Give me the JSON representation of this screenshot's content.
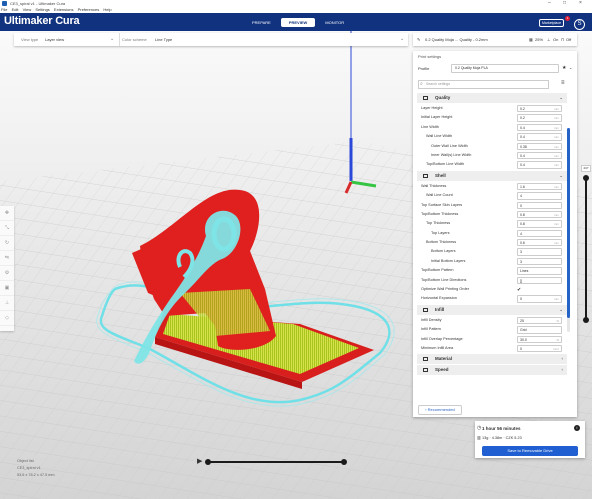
{
  "window": {
    "title": "CE3_spiral v1 - Ultimaker Cura"
  },
  "menu": [
    "File",
    "Edit",
    "View",
    "Settings",
    "Extensions",
    "Preferences",
    "Help"
  ],
  "header": {
    "logo": "Ultimaker Cura",
    "tabs": [
      "PREPARE",
      "PREVIEW",
      "MONITOR"
    ],
    "active_tab": "PREVIEW",
    "marketplace": "Marketplace",
    "badge": "1",
    "avatar": "S",
    "color": "#11327f"
  },
  "viewbar": {
    "view_type_label": "View type",
    "view_type_value": "Layer view",
    "color_scheme_label": "Color scheme",
    "color_scheme_value": "Line Type"
  },
  "printbar": {
    "profile": "0.2 Quality Moja ... Quality - 0.2mm",
    "infill": "25%",
    "support": "On",
    "adhesion": "Off"
  },
  "panel": {
    "title": "Print settings",
    "profile_label": "Profile",
    "profile_value": "0.2 Quality Moja PLA",
    "search_placeholder": "Search settings",
    "recommended": "Recommended"
  },
  "sections": [
    {
      "name": "Quality",
      "rows": [
        {
          "label": "Layer Height",
          "value": "0.2",
          "unit": "mm",
          "indent": 0
        },
        {
          "label": "Initial Layer Height",
          "value": "0.2",
          "unit": "mm",
          "indent": 0
        },
        {
          "label": "Line Width",
          "value": "0.4",
          "unit": "mm",
          "indent": 0
        },
        {
          "label": "Wall Line Width",
          "value": "0.4",
          "unit": "mm",
          "indent": 1
        },
        {
          "label": "Outer Wall Line Width",
          "value": "0.38",
          "unit": "mm",
          "indent": 2
        },
        {
          "label": "Inner Wall(s) Line Width",
          "value": "0.4",
          "unit": "mm",
          "indent": 2
        },
        {
          "label": "Top/Bottom Line Width",
          "value": "0.4",
          "unit": "mm",
          "indent": 1
        }
      ]
    },
    {
      "name": "Shell",
      "rows": [
        {
          "label": "Wall Thickness",
          "value": "1.6",
          "unit": "mm",
          "indent": 0
        },
        {
          "label": "Wall Line Count",
          "value": "4",
          "unit": "",
          "indent": 1
        },
        {
          "label": "Top Surface Skin Layers",
          "value": "0",
          "unit": "",
          "indent": 0
        },
        {
          "label": "Top/Bottom Thickness",
          "value": "0.8",
          "unit": "mm",
          "indent": 0
        },
        {
          "label": "Top Thickness",
          "value": "0.8",
          "unit": "mm",
          "indent": 1
        },
        {
          "label": "Top Layers",
          "value": "4",
          "unit": "",
          "indent": 2
        },
        {
          "label": "Bottom Thickness",
          "value": "0.6",
          "unit": "mm",
          "indent": 1
        },
        {
          "label": "Bottom Layers",
          "value": "3",
          "unit": "",
          "indent": 2
        },
        {
          "label": "Initial Bottom Layers",
          "value": "3",
          "unit": "",
          "indent": 2
        },
        {
          "label": "Top/Bottom Pattern",
          "value": "Lines",
          "unit": "",
          "indent": 0
        },
        {
          "label": "Top/Bottom Line Directions",
          "value": "[]",
          "unit": "",
          "indent": 0
        },
        {
          "label": "Optimize Wall Printing Order",
          "value": "✔",
          "unit": "",
          "indent": 0
        },
        {
          "label": "Horizontal Expansion",
          "value": "0",
          "unit": "mm",
          "indent": 0
        }
      ]
    },
    {
      "name": "Infill",
      "rows": [
        {
          "label": "Infill Density",
          "value": "25",
          "unit": "%",
          "indent": 0
        },
        {
          "label": "Infill Pattern",
          "value": "Grid",
          "unit": "",
          "indent": 0
        },
        {
          "label": "Infill Overlap Percentage",
          "value": "30.0",
          "unit": "%",
          "indent": 0
        },
        {
          "label": "Minimum Infill Area",
          "value": "0",
          "unit": "mm²",
          "indent": 0
        }
      ]
    },
    {
      "name": "Material",
      "rows": []
    },
    {
      "name": "Speed",
      "rows": []
    }
  ],
  "estimate": {
    "time": "1 hour 56 minutes",
    "material": "13g · 4.38m · CZK 5.23",
    "save": "Save to Removable Drive"
  },
  "object": {
    "list_label": "Object list",
    "name": "CE3_spiral v1",
    "dims": "53.6 x 78.2 x 47.5 mm"
  },
  "layer": {
    "top": "237"
  }
}
